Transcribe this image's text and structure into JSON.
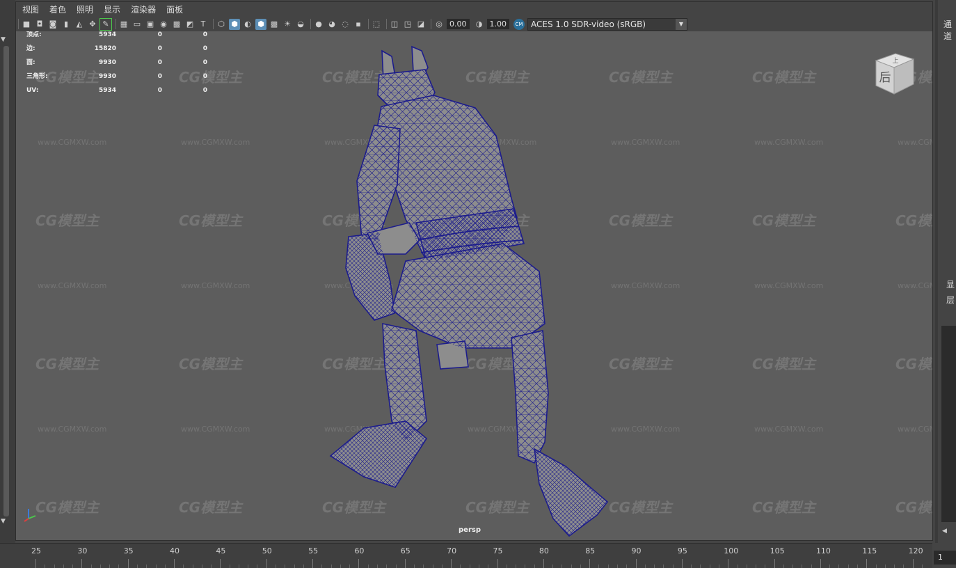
{
  "menubar": {
    "items": [
      "视图",
      "着色",
      "照明",
      "显示",
      "渲染器",
      "面板"
    ]
  },
  "toolbar": {
    "exposure_value": "0.00",
    "gamma_value": "1.00",
    "color_space_icon_text": "CM",
    "color_space": "ACES 1.0 SDR-video (sRGB)"
  },
  "hud": {
    "rows": [
      {
        "label": "顶点:",
        "v1": "5934",
        "v2": "0",
        "v3": "0"
      },
      {
        "label": "边:",
        "v1": "15820",
        "v2": "0",
        "v3": "0"
      },
      {
        "label": "面:",
        "v1": "9930",
        "v2": "0",
        "v3": "0"
      },
      {
        "label": "三角形:",
        "v1": "9930",
        "v2": "0",
        "v3": "0"
      },
      {
        "label": "UV:",
        "v1": "5934",
        "v2": "0",
        "v3": "0"
      }
    ]
  },
  "viewport": {
    "camera": "persp",
    "watermark_logo": "CG模型主",
    "watermark_url": "www.CGMXW.com",
    "wireframe_color": "#1c1c8c",
    "mesh_fill_color": "#8d8d8d"
  },
  "viewcube": {
    "front_face": "后",
    "top_face": "上"
  },
  "right_panel": {
    "tab_top": "通道",
    "label_display": "显",
    "label_layer": "层"
  },
  "timeline": {
    "ticks": [
      "25",
      "30",
      "35",
      "40",
      "45",
      "50",
      "55",
      "60",
      "65",
      "70",
      "75",
      "80",
      "85",
      "90",
      "95",
      "100",
      "105",
      "110",
      "115",
      "120"
    ],
    "current_frame": "1"
  }
}
